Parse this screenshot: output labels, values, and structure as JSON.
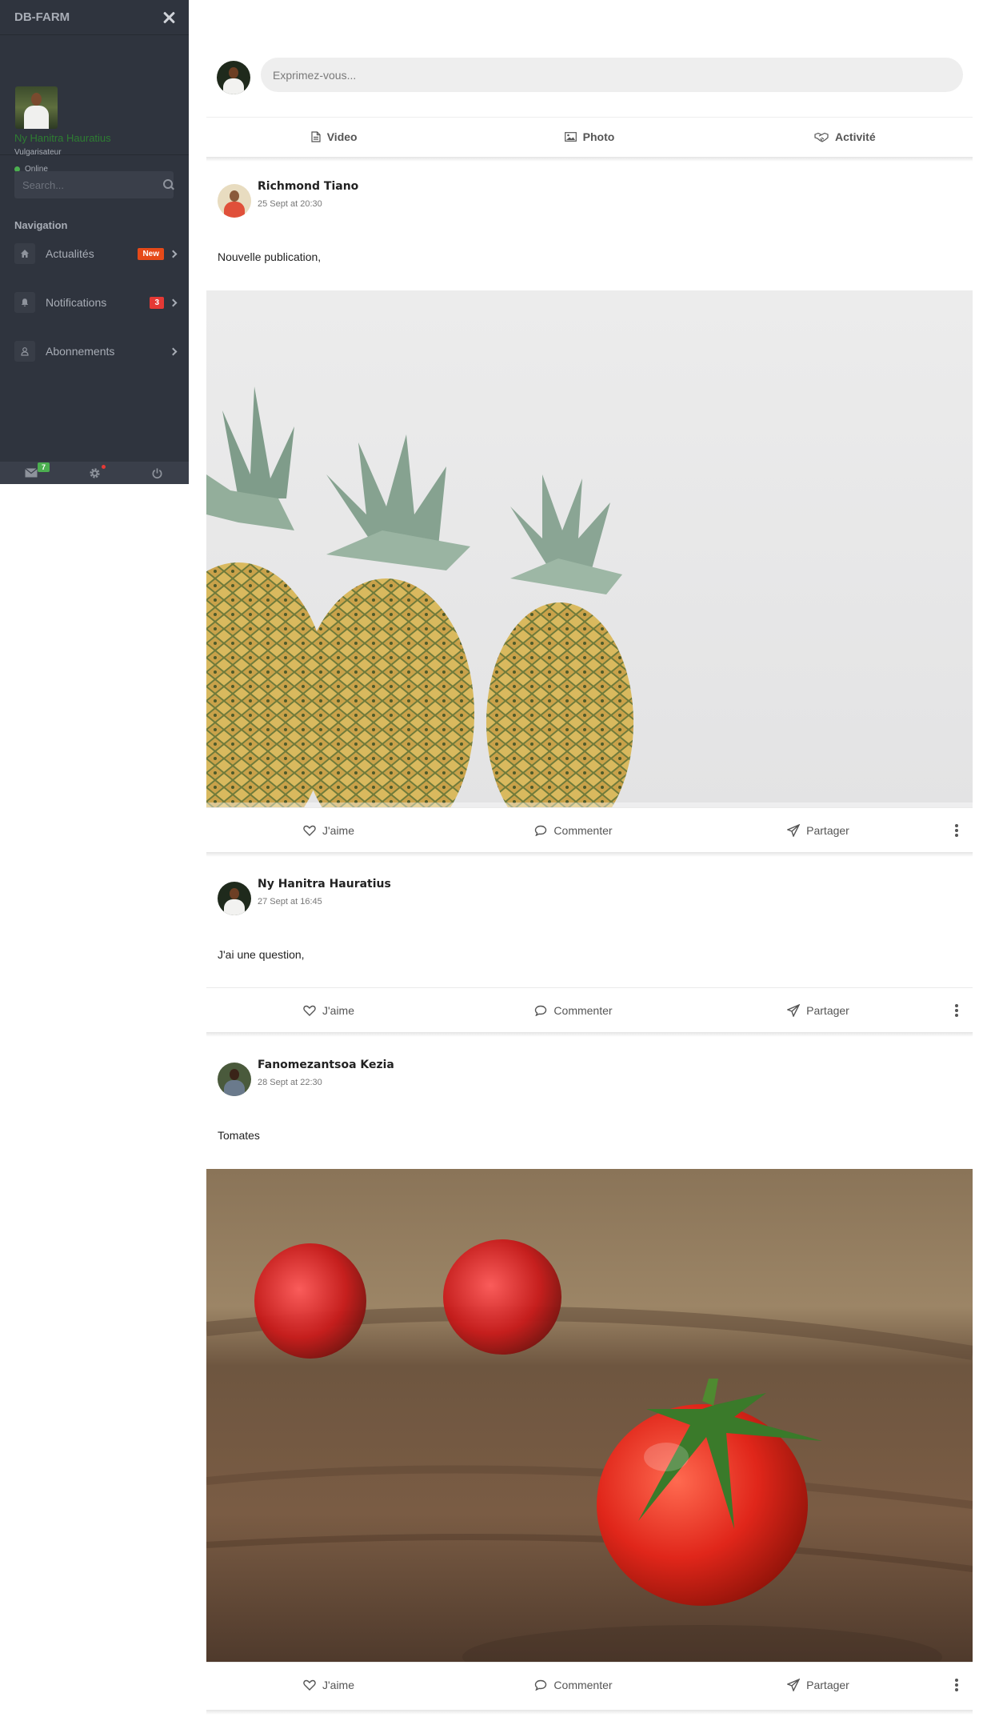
{
  "sidebar": {
    "brand": "DB-FARM",
    "profile": {
      "name": "Ny Hanitra Hauratius",
      "role": "Vulgarisateur",
      "status": "Online"
    },
    "search": {
      "placeholder": "Search..."
    },
    "nav_title": "Navigation",
    "items": [
      {
        "label": "Actualités",
        "badge": "New",
        "icon": "home-icon"
      },
      {
        "label": "Notifications",
        "badge": "3",
        "icon": "bell-icon"
      },
      {
        "label": "Abonnements",
        "badge": "",
        "icon": "user-icon"
      }
    ],
    "footer": {
      "mail_count": "7"
    }
  },
  "composer": {
    "placeholder": "Exprimez-vous...",
    "actions": [
      {
        "label": "Video",
        "icon": "file-icon"
      },
      {
        "label": "Photo",
        "icon": "image-icon"
      },
      {
        "label": "Activité",
        "icon": "handshake-icon"
      }
    ]
  },
  "posts": [
    {
      "author": "Richmond Tiano",
      "date": "25 Sept at 20:30",
      "text": "Nouvelle publication,",
      "image": "pineapples"
    },
    {
      "author": "Ny Hanitra Hauratius",
      "date": "27 Sept at 16:45",
      "text": "J'ai une question,",
      "image": ""
    },
    {
      "author": "Fanomezantsoa Kezia",
      "date": "28 Sept at 22:30",
      "text": "Tomates",
      "image": "tomatoes"
    }
  ],
  "post_actions": {
    "like": "J'aime",
    "comment": "Commenter",
    "share": "Partager"
  }
}
